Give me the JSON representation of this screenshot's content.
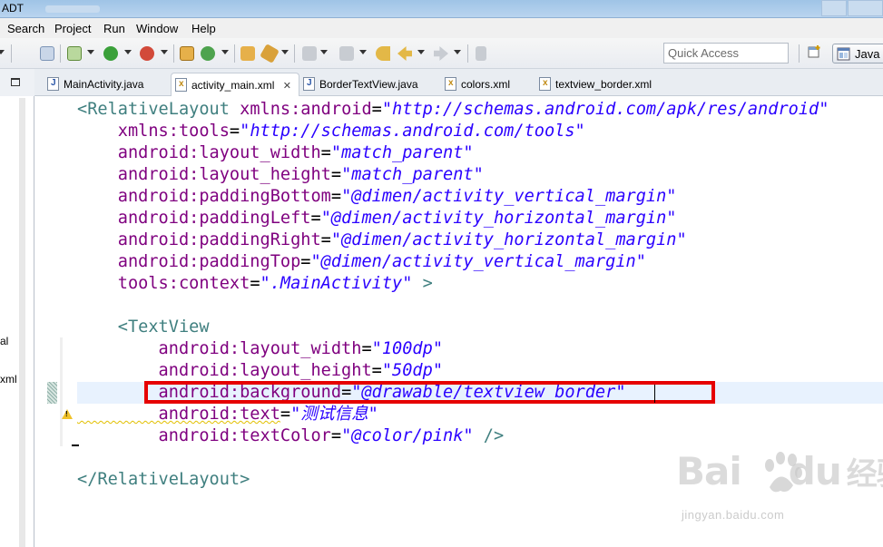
{
  "window": {
    "title": "ADT"
  },
  "menu": [
    "Search",
    "Project",
    "Run",
    "Window",
    "Help"
  ],
  "toolbar": {
    "quick_access_placeholder": "Quick Access",
    "perspective": "Java",
    "icons": [
      "run-dropdown-icon",
      "bug-icon",
      "debug-icon",
      "run-icon",
      "coverage-icon",
      "new-java-package-icon",
      "new-class-icon",
      "open-type-icon",
      "search-icon",
      "next-annotation-icon",
      "prev-annotation-icon",
      "last-edit-icon",
      "back-icon",
      "forward-icon",
      "pin-icon",
      "open-perspective-icon"
    ]
  },
  "left_panel": {
    "fragments": [
      "al",
      "xml"
    ]
  },
  "tabs": [
    {
      "label": "MainActivity.java",
      "type": "java",
      "active": false
    },
    {
      "label": "activity_main.xml",
      "type": "xml",
      "active": true,
      "close": "✕"
    },
    {
      "label": "BorderTextView.java",
      "type": "java",
      "active": false
    },
    {
      "label": "colors.xml",
      "type": "xml",
      "active": false
    },
    {
      "label": "textview_border.xml",
      "type": "xml",
      "active": false
    }
  ],
  "code_lines": [
    [
      [
        "tag",
        "<RelativeLayout "
      ],
      [
        "attr",
        "xmlns:android"
      ],
      [
        "eq",
        "="
      ],
      [
        "val",
        "\"http://schemas.android.com/apk/res/android\""
      ]
    ],
    [
      [
        "attr",
        "    xmlns:tools"
      ],
      [
        "eq",
        "="
      ],
      [
        "val",
        "\"http://schemas.android.com/tools\""
      ]
    ],
    [
      [
        "attr",
        "    android:layout_width"
      ],
      [
        "eq",
        "="
      ],
      [
        "val",
        "\"match_parent\""
      ]
    ],
    [
      [
        "attr",
        "    android:layout_height"
      ],
      [
        "eq",
        "="
      ],
      [
        "val",
        "\"match_parent\""
      ]
    ],
    [
      [
        "attr",
        "    android:paddingBottom"
      ],
      [
        "eq",
        "="
      ],
      [
        "val",
        "\"@dimen/activity_vertical_margin\""
      ]
    ],
    [
      [
        "attr",
        "    android:paddingLeft"
      ],
      [
        "eq",
        "="
      ],
      [
        "val",
        "\"@dimen/activity_horizontal_margin\""
      ]
    ],
    [
      [
        "attr",
        "    android:paddingRight"
      ],
      [
        "eq",
        "="
      ],
      [
        "val",
        "\"@dimen/activity_horizontal_margin\""
      ]
    ],
    [
      [
        "attr",
        "    android:paddingTop"
      ],
      [
        "eq",
        "="
      ],
      [
        "val",
        "\"@dimen/activity_vertical_margin\""
      ]
    ],
    [
      [
        "attr",
        "    tools:context"
      ],
      [
        "eq",
        "="
      ],
      [
        "val",
        "\".MainActivity\""
      ],
      [
        "tag",
        " >"
      ]
    ],
    [],
    [
      [
        "tag",
        "    <TextView"
      ]
    ],
    [
      [
        "attr",
        "        android:layout_width"
      ],
      [
        "eq",
        "="
      ],
      [
        "val",
        "\"100dp\""
      ]
    ],
    [
      [
        "attr",
        "        android:layout_height"
      ],
      [
        "eq",
        "="
      ],
      [
        "val",
        "\"50dp\""
      ]
    ],
    [
      [
        "attr",
        "        android:background"
      ],
      [
        "eq",
        "="
      ],
      [
        "val",
        "\"@drawable/textview_border\""
      ]
    ],
    [
      [
        "attr",
        "        android:text"
      ],
      [
        "eq",
        "="
      ],
      [
        "val",
        "\"测试信息\""
      ]
    ],
    [
      [
        "attr",
        "        android:textColor"
      ],
      [
        "eq",
        "="
      ],
      [
        "val",
        "\"@color/pink\""
      ],
      [
        "tag",
        " />"
      ]
    ],
    [],
    [
      [
        "tag",
        "</RelativeLayout>"
      ]
    ]
  ],
  "highlight_line": 13,
  "warning_line": 14,
  "watermark": {
    "text": "Bai",
    "suffix": "du",
    "cn": "经验",
    "url": "jingyan.baidu.com"
  }
}
